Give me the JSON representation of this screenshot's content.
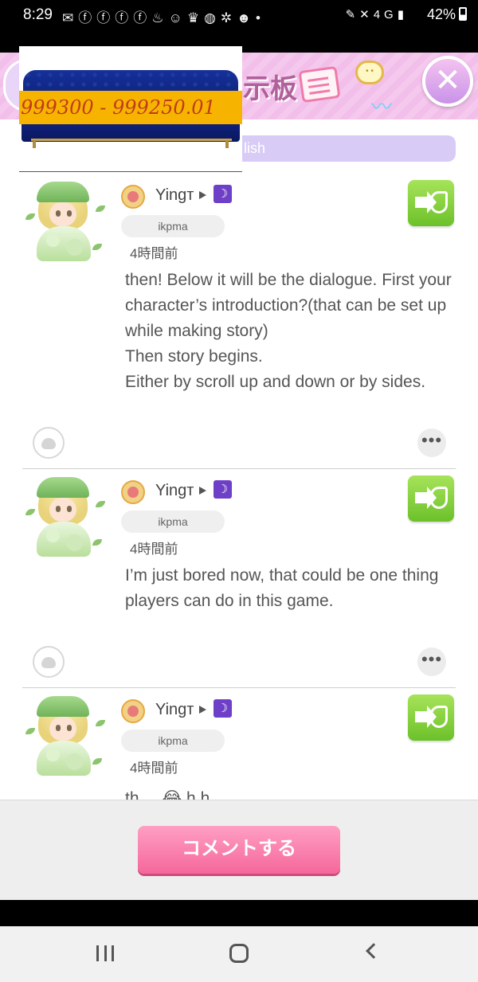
{
  "status_bar": {
    "time": "8:29",
    "battery": "42%",
    "network": "4G"
  },
  "header": {
    "title": "示板",
    "close_label": "✕"
  },
  "ad_overlay": {
    "price_text": "999300 - 999250.01"
  },
  "language_filter": {
    "label": "lish"
  },
  "posts": [
    {
      "username": "Yingт",
      "tag": "ikpma",
      "time": "4時間前",
      "text": "then! Below it will be the dialogue. First your character’s introduction?(that can be set up while making story)\nThen story begins.\nEither by scroll up and down or by sides."
    },
    {
      "username": "Yingт",
      "tag": "ikpma",
      "time": "4時間前",
      "text": "I’m just bored now, that could be one thing players can do in this game."
    },
    {
      "username": "Yingт",
      "tag": "ikpma",
      "time": "4時間前",
      "text": "th ... 😂 h h"
    }
  ],
  "footer": {
    "comment_button": "コメントする"
  },
  "colors": {
    "header_pink": "#f5c8ee",
    "reply_green": "#6cc12a",
    "comment_pink": "#f4679b",
    "moon_purple": "#6e3fc7",
    "lang_pill": "#d8ccf6"
  },
  "icons": {
    "reply": "speech-arrow-icon",
    "reaction": "blob-reaction-icon",
    "more": "more-dots-icon",
    "badge": "pizza-badge-icon",
    "rank": "moon-icon"
  }
}
